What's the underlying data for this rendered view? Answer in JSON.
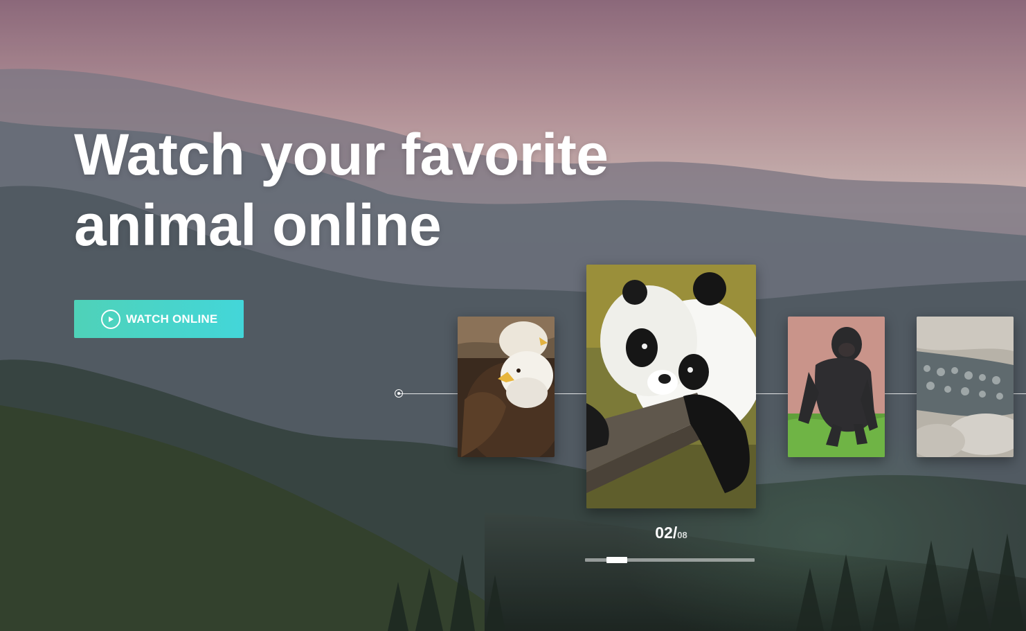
{
  "hero": {
    "title_line1": "Watch your favorite",
    "title_line2": "animal online",
    "cta_label": "WATCH ONLINE",
    "cta_icon": "play-circle-icon"
  },
  "slider": {
    "items": [
      {
        "name": "eagle"
      },
      {
        "name": "panda"
      },
      {
        "name": "gorilla"
      },
      {
        "name": "crocodile"
      }
    ],
    "active_index": 1,
    "counter_current": "02",
    "counter_separator": "/",
    "counter_total": "08",
    "progress_fraction": 0.25
  },
  "colors": {
    "cta_gradient_start": "#4fd2b8",
    "cta_gradient_end": "#43d6d9",
    "text": "#ffffff",
    "sky_top": "#a3788a"
  }
}
